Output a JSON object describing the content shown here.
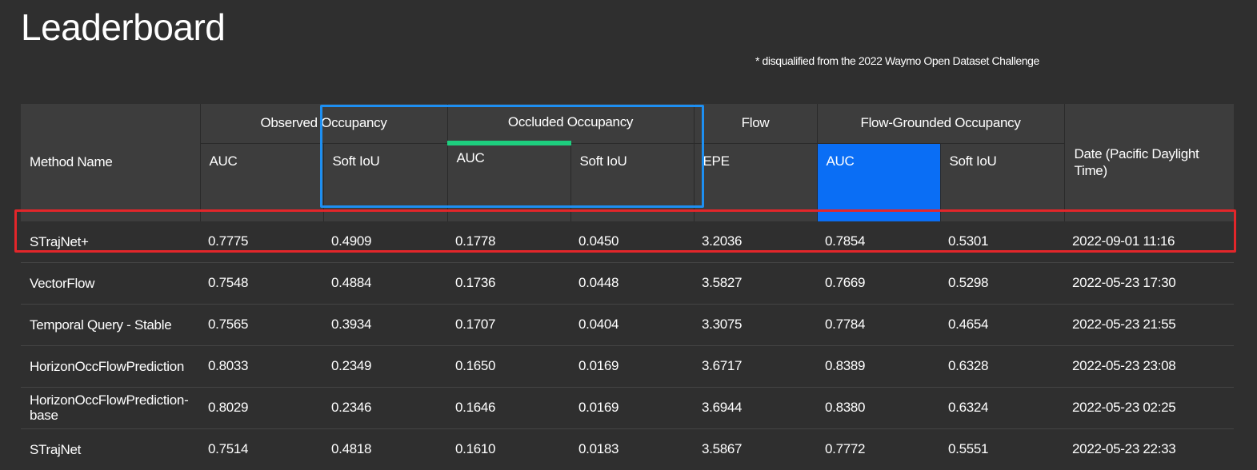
{
  "page": {
    "title": "Leaderboard",
    "note": "* disqualified from the 2022 Waymo Open Dataset Challenge"
  },
  "table": {
    "method_header": "Method Name",
    "date_header": "Date (Pacific Daylight Time)",
    "groups": [
      "Observed Occupancy",
      "Occluded Occupancy",
      "Flow",
      "Flow-Grounded Occupancy"
    ],
    "metrics": [
      "AUC",
      "Soft IoU",
      "AUC",
      "Soft IoU",
      "EPE",
      "AUC",
      "Soft IoU"
    ],
    "active_metric": "Flow-Grounded Occupancy AUC",
    "rows": [
      {
        "name": "STrajNet+",
        "values": [
          "0.7775",
          "0.4909",
          "0.1778",
          "0.0450",
          "3.2036",
          "0.7854",
          "0.5301"
        ],
        "date": "2022-09-01 11:16"
      },
      {
        "name": "VectorFlow",
        "values": [
          "0.7548",
          "0.4884",
          "0.1736",
          "0.0448",
          "3.5827",
          "0.7669",
          "0.5298"
        ],
        "date": "2022-05-23 17:30"
      },
      {
        "name": "Temporal Query - Stable",
        "values": [
          "0.7565",
          "0.3934",
          "0.1707",
          "0.0404",
          "3.3075",
          "0.7784",
          "0.4654"
        ],
        "date": "2022-05-23 21:55"
      },
      {
        "name": "HorizonOccFlowPrediction",
        "values": [
          "0.8033",
          "0.2349",
          "0.1650",
          "0.0169",
          "3.6717",
          "0.8389",
          "0.6328"
        ],
        "date": "2022-05-23 23:08"
      },
      {
        "name": "HorizonOccFlowPrediction-base",
        "values": [
          "0.8029",
          "0.2346",
          "0.1646",
          "0.0169",
          "3.6944",
          "0.8380",
          "0.6324"
        ],
        "date": "2022-05-23 02:25"
      },
      {
        "name": "STrajNet",
        "values": [
          "0.7514",
          "0.4818",
          "0.1610",
          "0.0183",
          "3.5867",
          "0.7772",
          "0.5551"
        ],
        "date": "2022-05-23 22:33"
      }
    ]
  },
  "colors": {
    "background": "#2f2f2f",
    "header_bg": "#3d3d3d",
    "active_sort": "#0a6ef5",
    "occluded_accent": "#1ecf7f",
    "blue_highlight": "#1d8ff2",
    "red_highlight": "#e3262a"
  }
}
